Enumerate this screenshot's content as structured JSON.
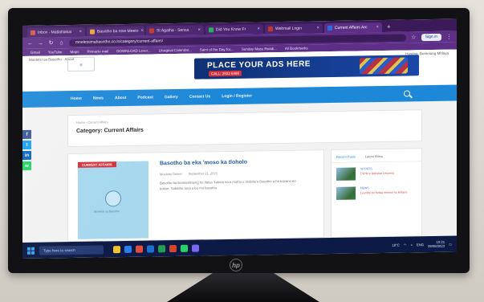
{
  "browser": {
    "tabs": [
      {
        "label": "Inbox - Matlahlakai",
        "active": false,
        "favicon_color": "#d9534f"
      },
      {
        "label": "Basotho ba ntse Meeto",
        "active": false,
        "favicon_color": "#e8a33a"
      },
      {
        "label": "St Agatha - Sensa",
        "active": false,
        "favicon_color": "#c0392b"
      },
      {
        "label": "Did You Know Fr",
        "active": false,
        "favicon_color": "#27ae60"
      },
      {
        "label": "Webmail Login",
        "active": false,
        "favicon_color": "#c0392b"
      },
      {
        "label": "Current Affairs Arc",
        "active": true,
        "favicon_color": "#2d6cdf"
      }
    ],
    "new_tab": "+",
    "url": "moeletsimabasotho.co.ls/category/current-affairs/",
    "signin_label": "Sign in",
    "bookmarks": [
      "Gmail",
      "YouTube",
      "Maps",
      "Pinnacle mail",
      "DOWNLOAD Lever...",
      "Liturgical Calendar...",
      "Saint of the Day for...",
      "Sunday Mass Readi...",
      "All Bookmarks"
    ]
  },
  "site": {
    "top_left": "Moeletsi oa Basotho   ·   About",
    "top_right": "Hosting, Bomelong Mhlaya",
    "banner_text": "PLACE YOUR ADS HERE",
    "banner_phone": "CALL: 2822 6488",
    "nav": [
      "Home",
      "News",
      "About",
      "Podcast",
      "Gallery",
      "Contact Us",
      "Login / Register"
    ],
    "social": [
      {
        "icon": "facebook-icon",
        "glyph": "f",
        "color": "#3b5998"
      },
      {
        "icon": "twitter-icon",
        "glyph": "t",
        "color": "#1da1f2"
      },
      {
        "icon": "linkedin-icon",
        "glyph": "in",
        "color": "#0a66c2"
      },
      {
        "icon": "whatsapp-icon",
        "glyph": "w",
        "color": "#25d366"
      }
    ],
    "breadcrumb": "Home  ›  Current Affairs",
    "category_title": "Category: Current Affairs",
    "post": {
      "badge": "CURRENT AFFAIRS",
      "thumb_caption": "Moeletsi oa Basotho",
      "title": "Basotho ba eka 'moso ka tloholo",
      "author": "Moeletsi Online",
      "date": "September 21, 2023",
      "excerpt": "Basotho ba ikemiselitseng ho tlatsa 'kokota ea e motho e mabilio'a Basotho a ha kopano eo bokoe. Sabatho tona a bo mo basotho."
    },
    "sidebar": {
      "tabs": [
        "Recent Posts",
        "Latest Video"
      ],
      "items": [
        {
          "category": "SPORTS",
          "text": "LSPM e lekhetse Letsema"
        },
        {
          "category": "NEWS",
          "text": "Lesotho ho holisa melimo ea lehlano"
        }
      ]
    }
  },
  "taskbar": {
    "search_placeholder": "Type here to search",
    "weather": "18°C",
    "language": "ENG",
    "time": "10:21",
    "date": "09/08/2023"
  },
  "monitor": {
    "brand": "hp"
  }
}
